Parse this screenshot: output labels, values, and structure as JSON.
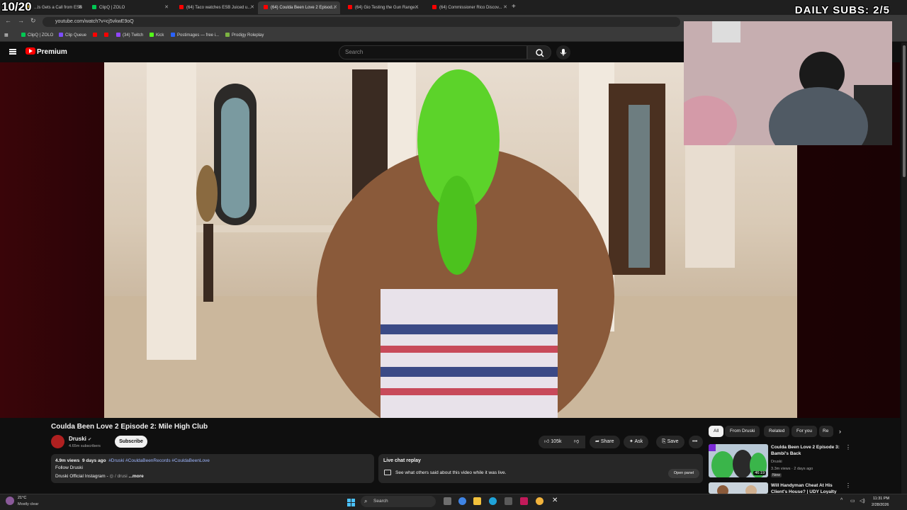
{
  "overlay": {
    "count": "10/20",
    "daily_subs": "DAILY SUBS: 2/5"
  },
  "tabs": [
    {
      "label": "...ls Gets a Call from ESB",
      "fav": "#ffcc00"
    },
    {
      "label": "ClipQ | ZOLO",
      "fav": "#00c853"
    },
    {
      "label": "(64) Taco watches ESB Juiced u...",
      "fav": "#ff0000"
    },
    {
      "label": "(64) Coulda Been Love 2 Episod...",
      "fav": "#ff0000",
      "active": true
    },
    {
      "label": "(64) Gio Testing the Gun Range...",
      "fav": "#ff0000"
    },
    {
      "label": "(64) Commissioner Rico Discov...",
      "fav": "#ff0000"
    }
  ],
  "browser": {
    "url": "youtube.com/watch?v=cj5vkwE9oQ"
  },
  "bookmarks": [
    {
      "label": "ClipQ | ZOLO",
      "fav": "#00c853"
    },
    {
      "label": "Clip Queue",
      "fav": "#7c4dff"
    },
    {
      "label": "",
      "fav": "#ff0000"
    },
    {
      "label": "",
      "fav": "#ff0000"
    },
    {
      "label": "(34) Twitch",
      "fav": "#9146ff"
    },
    {
      "label": "Kick",
      "fav": "#53fc18"
    },
    {
      "label": "Postimages — free i...",
      "fav": "#2962ff"
    },
    {
      "label": "Prodigy Roleplay",
      "fav": "#7cb342"
    }
  ],
  "youtube": {
    "brand": "Premium",
    "search_placeholder": "Search"
  },
  "video": {
    "title": "Coulda Been Love 2 Episode 2: Mile High Club",
    "channel": "Druski",
    "subscribers": "4.65m subscribers",
    "subscribe_label": "Subscribe",
    "likes": "105k",
    "share_label": "Share",
    "ask_label": "Ask",
    "save_label": "Save"
  },
  "description": {
    "views": "4.9m views",
    "age": "9 days ago",
    "tags": "#Druski #CouldaBeenRecords #CouldaBeenLove",
    "line2": "Follow Druski",
    "line3": "Druski Official Instagram - ",
    "line3_tail": "/ drusi",
    "more": "...more"
  },
  "chat": {
    "title": "Live chat replay",
    "desc": "See what others said about this video while it was live.",
    "open_label": "Open panel"
  },
  "chips": [
    "All",
    "From Druski",
    "Related",
    "For you",
    "Re"
  ],
  "recommendations": [
    {
      "title": "Coulda Been Love 2 Episode 3: Bambi's Back",
      "channel": "Druski",
      "meta": "3.3m views · 2 days ago",
      "badge": "New",
      "duration": "46:19"
    },
    {
      "title": "Will Handyman Cheat At His Client's House? | UDY Loyalty",
      "channel": "",
      "meta": "",
      "badge": "",
      "duration": ""
    }
  ],
  "taskbar": {
    "temp": "21°C",
    "weather": "Mostly clear",
    "search": "Search",
    "time": "11:31 PM",
    "date": "2/28/2026"
  },
  "colors": {
    "yt_red": "#ff0000",
    "bg": "#0f0f0f",
    "chip_bg": "#272727",
    "tag_blue": "#9fb7ff"
  }
}
